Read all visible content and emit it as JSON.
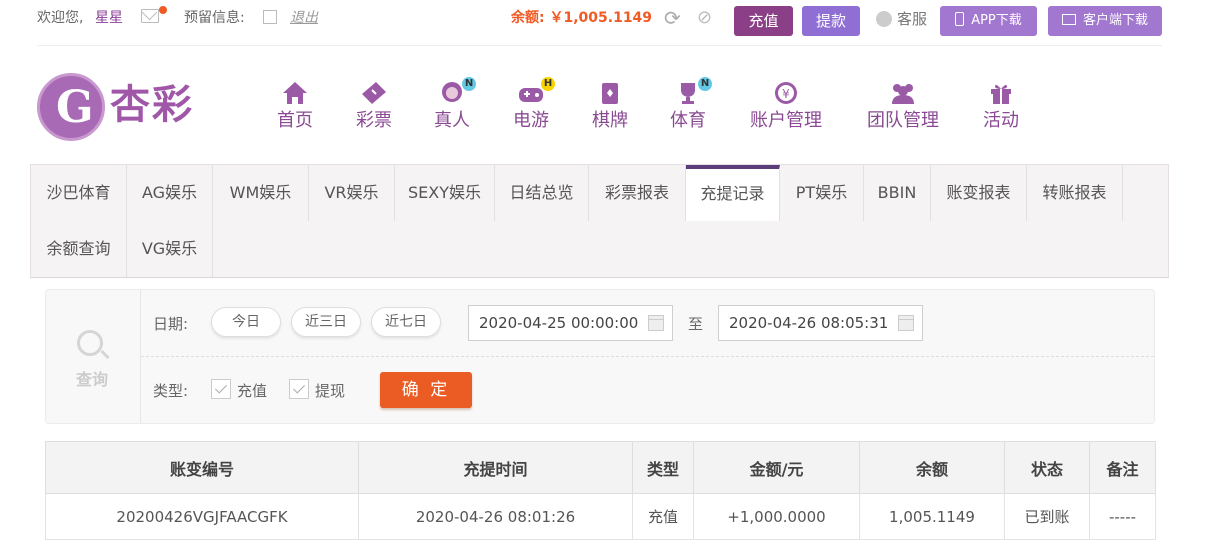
{
  "topbar": {
    "welcome": "欢迎您,",
    "username": "星星",
    "reserve_label": "预留信息:",
    "logout": "退出",
    "balance": "余额: ￥1,005.1149",
    "recharge": "充值",
    "withdraw": "提款",
    "service": "客服",
    "app_download": "APP下载",
    "client_download": "客户端下载"
  },
  "logo": {
    "text": "杏彩"
  },
  "nav": [
    {
      "label": "首页",
      "icon": "home-icon"
    },
    {
      "label": "彩票",
      "icon": "lottery-icon"
    },
    {
      "label": "真人",
      "icon": "live-icon",
      "badge": "N"
    },
    {
      "label": "电游",
      "icon": "gamepad-icon",
      "badge": "H"
    },
    {
      "label": "棋牌",
      "icon": "cards-icon"
    },
    {
      "label": "体育",
      "icon": "trophy-icon",
      "badge": "N"
    },
    {
      "label": "账户管理",
      "icon": "yen-coin-icon"
    },
    {
      "label": "团队管理",
      "icon": "team-icon"
    },
    {
      "label": "活动",
      "icon": "gift-icon"
    }
  ],
  "tabs": [
    "沙巴体育",
    "AG娱乐",
    "WM娱乐",
    "VR娱乐",
    "SEXY娱乐",
    "日结总览",
    "彩票报表",
    "充提记录",
    "PT娱乐",
    "BBIN",
    "账变报表",
    "转账报表",
    "余额查询",
    "VG娱乐"
  ],
  "active_tab": "充提记录",
  "query": {
    "search_label": "查询",
    "date_label": "日期:",
    "quick_dates": [
      "今日",
      "近三日",
      "近七日"
    ],
    "start": "2020-04-25 00:00:00",
    "to": "至",
    "end": "2020-04-26 08:05:31",
    "type_label": "类型:",
    "types": [
      "充值",
      "提现"
    ],
    "confirm": "确 定"
  },
  "table": {
    "headers": [
      "账变编号",
      "充提时间",
      "类型",
      "金额/元",
      "余额",
      "状态",
      "备注"
    ],
    "rows": [
      [
        "20200426VGJFAACGFK",
        "2020-04-26 08:01:26",
        "充值",
        "+1,000.0000",
        "1,005.1149",
        "已到账",
        "-----"
      ]
    ]
  },
  "colors": {
    "brand": "#8a4a93",
    "accent": "#ea5c23",
    "amount": "#c6001d",
    "success": "#2ca10c"
  }
}
